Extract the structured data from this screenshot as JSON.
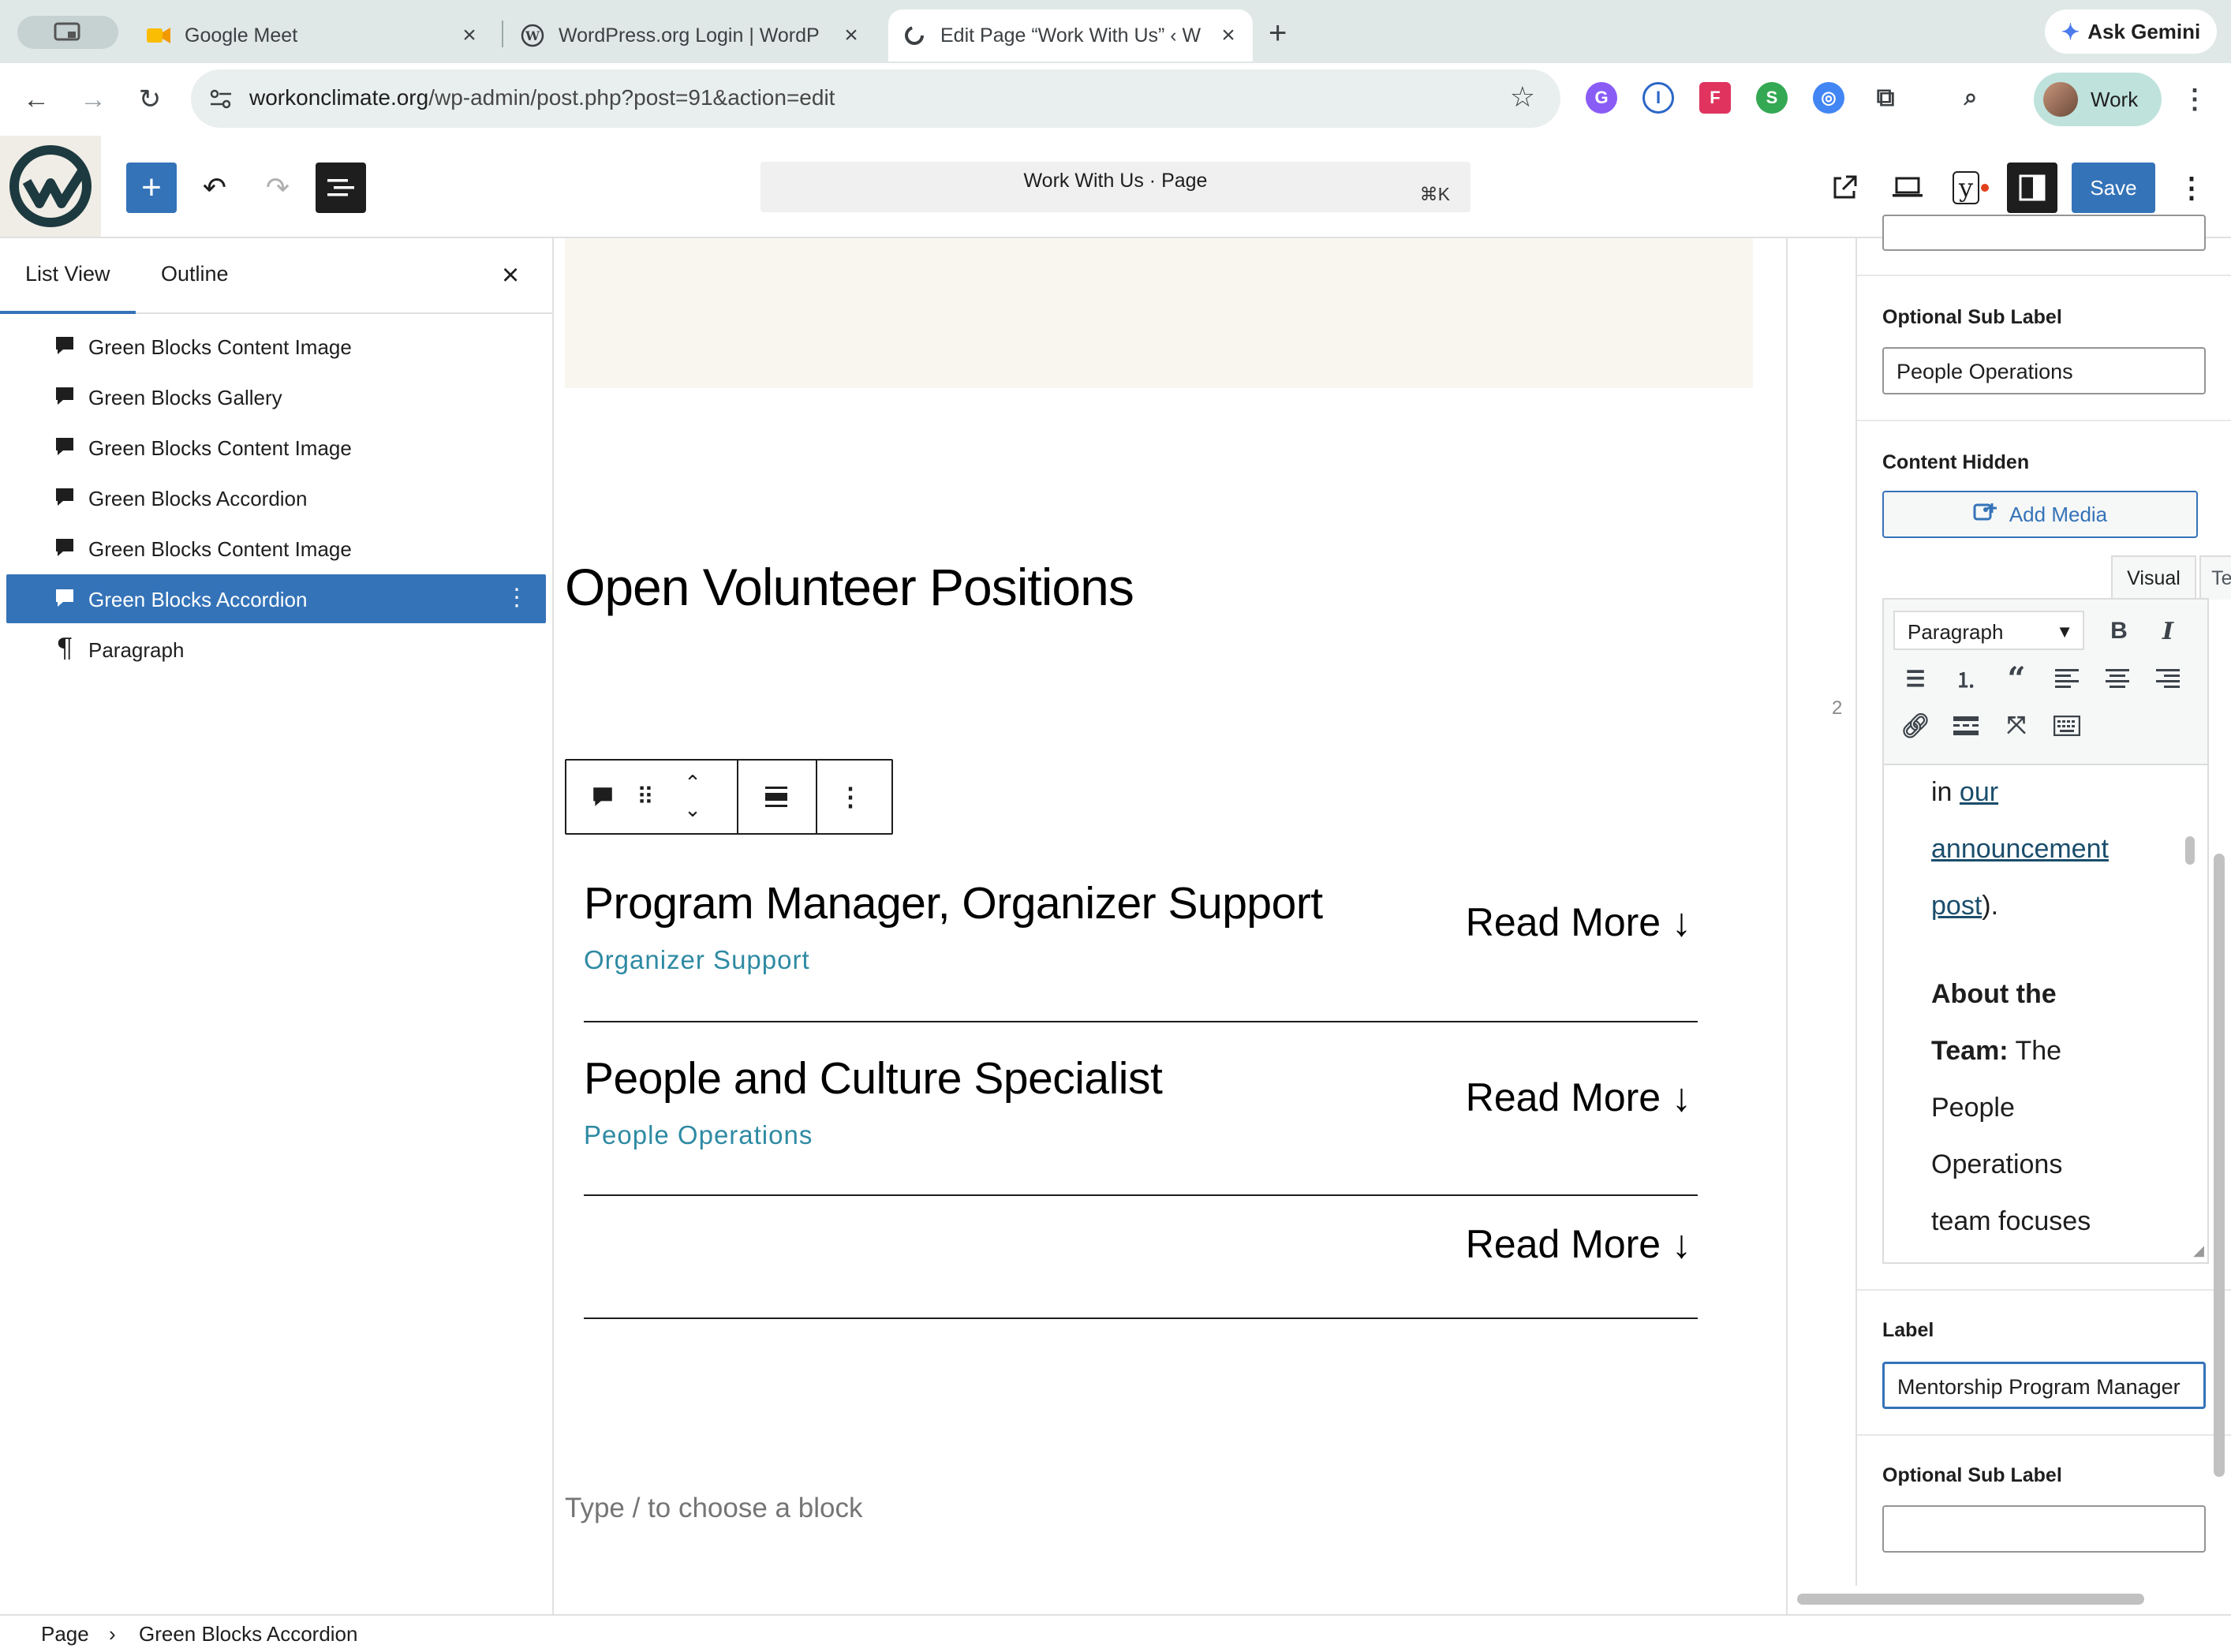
{
  "browser": {
    "tabs": [
      {
        "title": "Google Meet",
        "favicon": "google-meet-icon"
      },
      {
        "title": "WordPress.org Login | WordPr",
        "favicon": "wordpress-icon"
      },
      {
        "title": "Edit Page “Work With Us” ‹ W",
        "favicon": "site-favicon"
      }
    ],
    "url_host": "workonclimate.org",
    "url_path": "/wp-admin/post.php?post=91&action=edit",
    "profile_label": "Work",
    "gemini_label": "Ask Gemini"
  },
  "editor_header": {
    "document_title": "Work With Us · Page",
    "shortcut": "⌘K",
    "save_label": "Save"
  },
  "list_view": {
    "tabs": [
      "List View",
      "Outline"
    ],
    "items": [
      {
        "label": "Green Blocks Content Image",
        "icon": "comment-block-icon"
      },
      {
        "label": "Green Blocks Gallery",
        "icon": "comment-block-icon"
      },
      {
        "label": "Green Blocks Content Image",
        "icon": "comment-block-icon"
      },
      {
        "label": "Green Blocks Accordion",
        "icon": "comment-block-icon"
      },
      {
        "label": "Green Blocks Content Image",
        "icon": "comment-block-icon"
      },
      {
        "label": "Green Blocks Accordion",
        "icon": "comment-block-icon",
        "selected": true
      },
      {
        "label": "Paragraph",
        "icon": "pilcrow-icon"
      }
    ]
  },
  "canvas": {
    "heading": "Open Volunteer Positions",
    "accordion": [
      {
        "title": "Program Manager, Organizer Support",
        "subtitle": "Organizer Support",
        "action": "Read More ↓"
      },
      {
        "title": "People and Culture Specialist",
        "subtitle": "People Operations",
        "action": "Read More ↓"
      },
      {
        "title": "",
        "subtitle": "",
        "action": "Read More ↓"
      }
    ],
    "placeholder": "Type / to choose a block"
  },
  "sidebar": {
    "item_number": "2",
    "optional_sub_label_1": "Optional Sub Label",
    "sub_label_value_1": "People Operations",
    "content_hidden_label": "Content Hidden",
    "add_media_label": "Add Media",
    "editor_tabs": [
      "Visual",
      "Text"
    ],
    "format_select": "Paragraph",
    "content_lines": {
      "l1_pre": "in ",
      "l1_link": "our",
      "l2_link": "announcement",
      "l3_link": "post",
      "l3_post": ").",
      "l4_bold": "About the",
      "l5_bold": "Team:",
      "l5_post": " The",
      "l6": "People",
      "l7": "Operations",
      "l8": "team focuses"
    },
    "label_title": "Label",
    "label_value": "Mentorship Program Manager",
    "optional_sub_label_2": "Optional Sub Label",
    "sub_label_value_2": ""
  },
  "breadcrumb": {
    "root": "Page",
    "separator": "›",
    "current": "Green Blocks Accordion"
  },
  "colors": {
    "wp_blue": "#3473b8",
    "accent_teal": "#2e8aa3",
    "chrome_bar": "#dfe8e7"
  }
}
